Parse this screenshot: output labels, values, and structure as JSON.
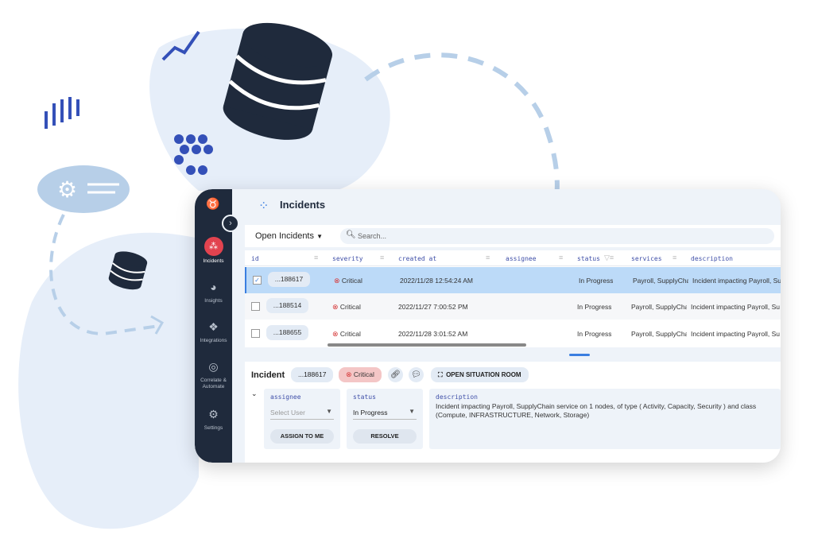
{
  "sidebar": {
    "items": [
      {
        "label": "Incidents",
        "icon": "incidents-icon",
        "active": true
      },
      {
        "label": "Insights",
        "icon": "pie-chart-icon"
      },
      {
        "label": "Integrations",
        "icon": "integrations-icon"
      },
      {
        "label": "Correlate & Automate",
        "icon": "radar-icon"
      },
      {
        "label": "Settings",
        "icon": "gear-icon"
      }
    ]
  },
  "header": {
    "title": "Incidents"
  },
  "toolbar": {
    "filter": "Open Incidents",
    "search_placeholder": "Search..."
  },
  "table": {
    "columns": [
      "id",
      "severity",
      "created at",
      "assignee",
      "status",
      "services",
      "description"
    ],
    "rows": [
      {
        "id": "...188617",
        "severity": "Critical",
        "created": "2022/11/28 12:54:24 AM",
        "assignee": "",
        "status": "In Progress",
        "services": "Payroll, SupplyCha",
        "description": "Incident impacting Payroll, Su",
        "selected": true
      },
      {
        "id": "...188514",
        "severity": "Critical",
        "created": "2022/11/27 7:00:52 PM",
        "assignee": "",
        "status": "In Progress",
        "services": "Payroll, SupplyCha",
        "description": "Incident impacting Payroll, Su",
        "selected": false
      },
      {
        "id": "...188655",
        "severity": "Critical",
        "created": "2022/11/28 3:01:52 AM",
        "assignee": "",
        "status": "In Progress",
        "services": "Payroll, SupplyCha",
        "description": "Incident impacting Payroll, Su",
        "selected": false
      }
    ]
  },
  "detail": {
    "title": "Incident",
    "id": "...188617",
    "severity": "Critical",
    "situation_room": "OPEN SITUATION ROOM",
    "assignee_label": "assignee",
    "assignee_placeholder": "Select User",
    "assign_btn": "ASSIGN TO ME",
    "status_label": "status",
    "status_value": "In Progress",
    "resolve_btn": "RESOLVE",
    "description_label": "description",
    "description": "Incident impacting Payroll, SupplyChain service on 1 nodes, of type ( Activity, Capacity, Security ) and class (Compute, INFRASTRUCTURE, Network, Storage)"
  },
  "colors": {
    "sidebar": "#1f2a3c",
    "accent": "#3b7fe0",
    "critical": "#d63a3a",
    "selected_row": "#bcdaf8"
  }
}
